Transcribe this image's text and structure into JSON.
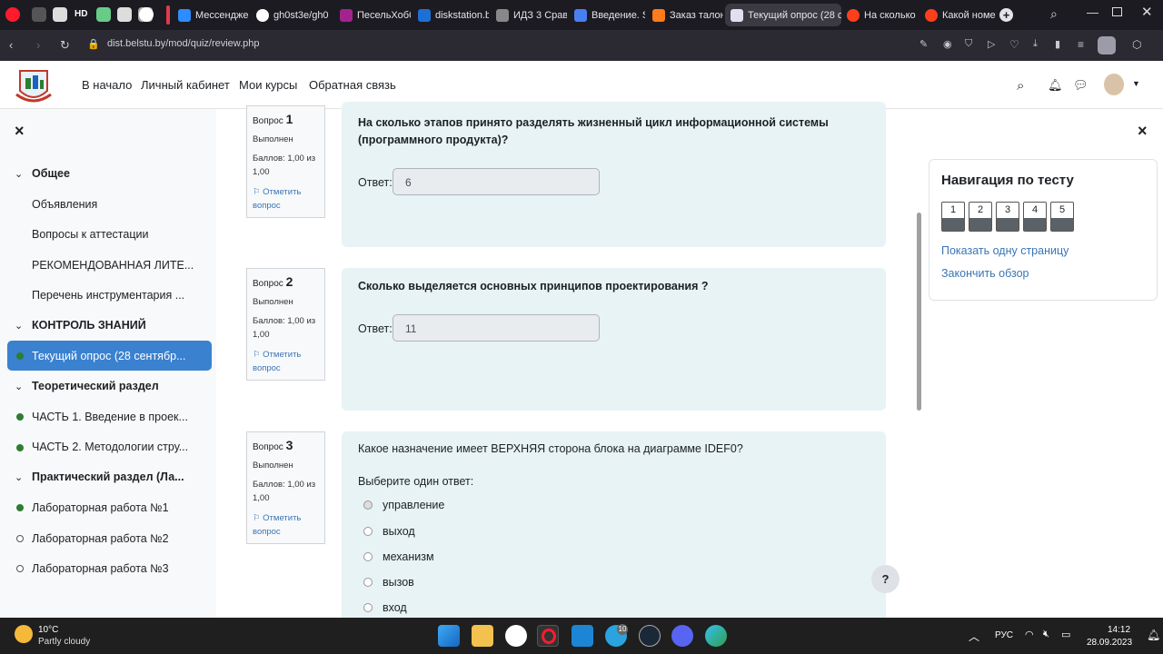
{
  "browser": {
    "pinned_tabs": [
      "Opera",
      "Settings",
      "Pause",
      "HD",
      "Tab",
      "Doc",
      "Video",
      "GitHub"
    ],
    "tabs": [
      {
        "label": "Мессенджер"
      },
      {
        "label": "gh0st3e/gh0"
      },
      {
        "label": "ПесельХобб"
      },
      {
        "label": "diskstation.b"
      },
      {
        "label": "ИДЗ 3 Сравн"
      },
      {
        "label": "Введение. SC"
      },
      {
        "label": "Заказ талона"
      },
      {
        "label": "Текущий опрос (28 се"
      },
      {
        "label": "На сколько э"
      },
      {
        "label": "Какой номер"
      }
    ],
    "new_tab": "+",
    "url": "dist.belstu.by/mod/quiz/review.php"
  },
  "header": {
    "nav": [
      "В начало",
      "Личный кабинет",
      "Мои курсы",
      "Обратная связь"
    ]
  },
  "drawer": {
    "close": "×",
    "items": [
      {
        "label": "Общее",
        "type": "section"
      },
      {
        "label": "Объявления",
        "type": "item"
      },
      {
        "label": "Вопросы к аттестации",
        "type": "item"
      },
      {
        "label": "РЕКОМЕНДОВАННАЯ ЛИТЕ...",
        "type": "item"
      },
      {
        "label": "Перечень инструментария ...",
        "type": "item"
      },
      {
        "label": "КОНТРОЛЬ ЗНАНИЙ",
        "type": "section"
      },
      {
        "label": "Текущий опрос (28 сентябр...",
        "type": "active"
      },
      {
        "label": "Теоретический раздел",
        "type": "section"
      },
      {
        "label": "ЧАСТЬ 1. Введение в проек...",
        "type": "done"
      },
      {
        "label": "ЧАСТЬ 2. Методологии стру...",
        "type": "done"
      },
      {
        "label": "Практический раздел (Ла...",
        "type": "section"
      },
      {
        "label": "Лабораторная работа №1",
        "type": "done"
      },
      {
        "label": "Лабораторная работа №2",
        "type": "todo"
      },
      {
        "label": "Лабораторная работа №3",
        "type": "todo"
      }
    ]
  },
  "questions": [
    {
      "num_label": "Вопрос",
      "num": "1",
      "status": "Выполнен",
      "score": "Баллов: 1,00 из",
      "score2": "1,00",
      "flag": "Отметить",
      "flag2": "вопрос",
      "text1": "На сколько этапов принято разделять жизненный цикл информационной системы",
      "text2": "(программного продукта)?",
      "answer_label": "Ответ:",
      "answer": "6"
    },
    {
      "num_label": "Вопрос",
      "num": "2",
      "status": "Выполнен",
      "score": "Баллов: 1,00 из",
      "score2": "1,00",
      "flag": "Отметить",
      "flag2": "вопрос",
      "text1": "Сколько выделяется основных принципов проектирования ?",
      "answer_label": "Ответ:",
      "answer": "11"
    },
    {
      "num_label": "Вопрос",
      "num": "3",
      "status": "Выполнен",
      "score": "Баллов: 1,00 из",
      "score2": "1,00",
      "flag": "Отметить",
      "flag2": "вопрос",
      "text1": "Какое назначение имеет ВЕРХНЯЯ сторона блока на диаграмме IDEF0?",
      "prompt": "Выберите один ответ:",
      "options": [
        "управление",
        "выход",
        "механизм",
        "вызов",
        "вход"
      ]
    }
  ],
  "quiz_nav": {
    "close": "×",
    "title": "Навигация по тесту",
    "buttons": [
      "1",
      "2",
      "3",
      "4",
      "5"
    ],
    "link1": "Показать одну страницу",
    "link2": "Закончить обзор"
  },
  "help": "?",
  "taskbar": {
    "weather_temp": "10°C",
    "weather_desc": "Partly cloudy",
    "lang": "РУС",
    "time": "14:12",
    "date": "28.09.2023",
    "badge": "10"
  }
}
